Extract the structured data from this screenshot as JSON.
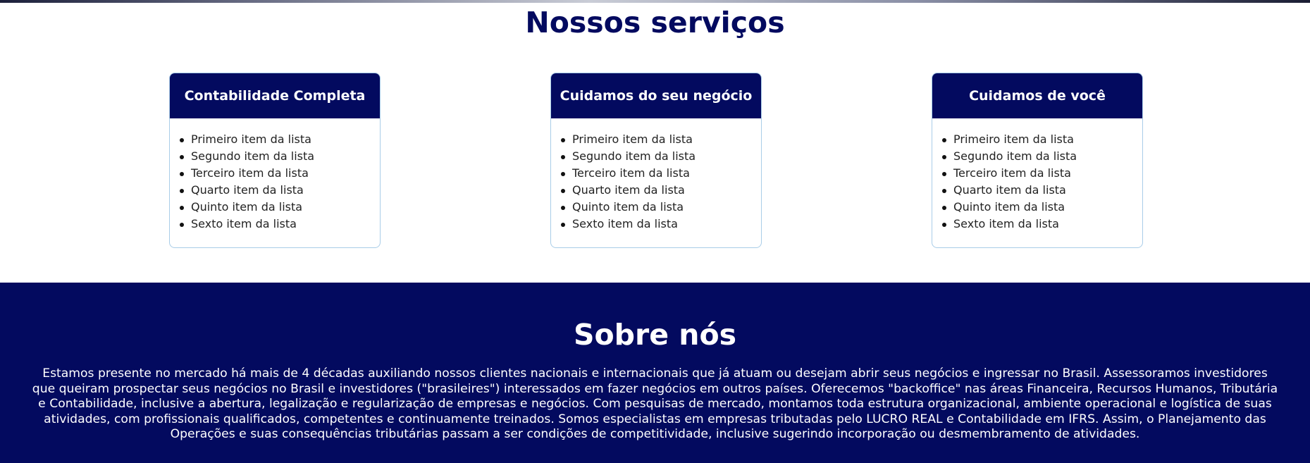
{
  "services": {
    "title": "Nossos serviços",
    "cards": [
      {
        "title": "Contabilidade Completa",
        "items": [
          "Primeiro item da lista",
          "Segundo item da lista",
          "Terceiro item da lista",
          "Quarto item da lista",
          "Quinto item da lista",
          "Sexto item da lista"
        ]
      },
      {
        "title": "Cuidamos do seu negócio",
        "items": [
          "Primeiro item da lista",
          "Segundo item da lista",
          "Terceiro item da lista",
          "Quarto item da lista",
          "Quinto item da lista",
          "Sexto item da lista"
        ]
      },
      {
        "title": "Cuidamos de você",
        "items": [
          "Primeiro item da lista",
          "Segundo item da lista",
          "Terceiro item da lista",
          "Quarto item da lista",
          "Quinto item da lista",
          "Sexto item da lista"
        ]
      }
    ]
  },
  "about": {
    "title": "Sobre nós",
    "text": "Estamos presente no mercado há mais de 4 décadas auxiliando nossos clientes nacionais e internacionais que já atuam ou desejam abrir seus negócios e ingressar no Brasil. Assessoramos investidores que queiram prospectar seus negócios no Brasil e investidores (\"brasileires\") interessados em fazer negócios em outros países. Oferecemos \"backoffice\" nas áreas Financeira, Recursos Humanos, Tributária e Contabilidade, inclusive a abertura, legalização e regularização de empresas e negócios. Com pesquisas de mercado, montamos toda estrutura organizacional, ambiente operacional e logística de suas atividades, com profissionais qualificados, competentes e continuamente treinados. Somos especialistas em empresas tributadas pelo LUCRO REAL e Contabilidade em IFRS. Assim, o Planejamento das Operações e suas consequências tributárias passam a ser condições de competitividade, inclusive sugerindo incorporação ou desmembramento de atividades."
  },
  "colors": {
    "brand_navy": "#030a5f",
    "card_border": "#a9cde8",
    "text_dark": "#222222",
    "white": "#ffffff"
  }
}
